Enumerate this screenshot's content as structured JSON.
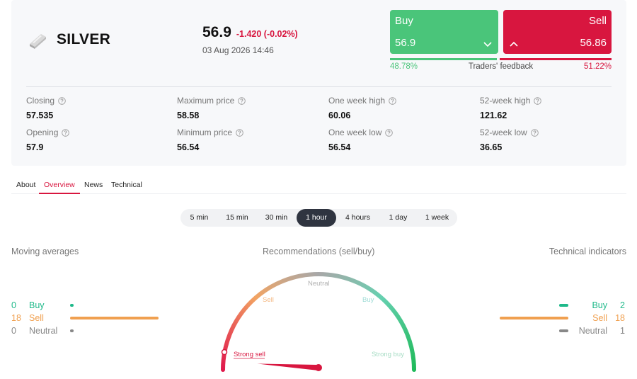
{
  "asset": {
    "name": "SILVER"
  },
  "quote": {
    "price": "56.9",
    "change": "-1.420 (-0.02%)",
    "datetime": "03 Aug 2026 14:46"
  },
  "trade": {
    "buy_label": "Buy",
    "buy_price": "56.9",
    "sell_label": "Sell",
    "sell_price": "56.86"
  },
  "feedback": {
    "buy_pct": "48.78%",
    "sell_pct": "51.22%",
    "buy_fraction": 0.4878,
    "sell_fraction": 0.5122,
    "title": "Traders' feedback"
  },
  "stats": [
    {
      "label": "Closing",
      "value": "57.535"
    },
    {
      "label": "Maximum price",
      "value": "58.58"
    },
    {
      "label": "One week high",
      "value": "60.06"
    },
    {
      "label": "52-week high",
      "value": "121.62"
    },
    {
      "label": "Opening",
      "value": "57.9"
    },
    {
      "label": "Minimum price",
      "value": "56.54"
    },
    {
      "label": "One week low",
      "value": "56.54"
    },
    {
      "label": "52-week low",
      "value": "36.65"
    }
  ],
  "tabs": [
    {
      "label": "About",
      "active": false
    },
    {
      "label": "Overview",
      "active": true
    },
    {
      "label": "News",
      "active": false
    },
    {
      "label": "Technical",
      "active": false
    }
  ],
  "periods": [
    {
      "label": "5 min",
      "active": false
    },
    {
      "label": "15 min",
      "active": false
    },
    {
      "label": "30 min",
      "active": false
    },
    {
      "label": "1 hour",
      "active": true
    },
    {
      "label": "4 hours",
      "active": false
    },
    {
      "label": "1 day",
      "active": false
    },
    {
      "label": "1 week",
      "active": false
    }
  ],
  "moving_averages": {
    "title": "Moving averages",
    "rows": [
      {
        "label": "Buy",
        "count": "0"
      },
      {
        "label": "Sell",
        "count": "18"
      },
      {
        "label": "Neutral",
        "count": "0"
      }
    ]
  },
  "recommendations": {
    "title": "Recommendations (sell/buy)",
    "labels": {
      "strong_sell": "Strong sell",
      "sell": "Sell",
      "neutral": "Neutral",
      "buy": "Buy",
      "strong_buy": "Strong buy"
    },
    "needle_value": 0.05
  },
  "technical_indicators": {
    "title": "Technical indicators",
    "rows": [
      {
        "label": "Buy",
        "count": "2"
      },
      {
        "label": "Sell",
        "count": "18"
      },
      {
        "label": "Neutral",
        "count": "1"
      }
    ]
  },
  "colors": {
    "buy": "#4ac57a",
    "sell": "#d8163f",
    "indicator_buy": "#1fb98a",
    "indicator_sell": "#f0a050",
    "indicator_neutral": "#888888"
  }
}
